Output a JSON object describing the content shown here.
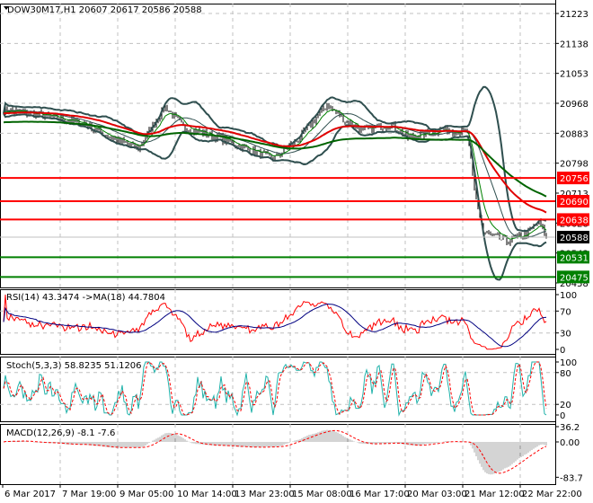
{
  "header": {
    "symbol": "DOW30M17,H1",
    "open": "20607",
    "high": "20617",
    "low": "20586",
    "close": "20588"
  },
  "chart_data": {
    "type": "line",
    "title": "DOW30M17,H1 20607 20617 20586 20588",
    "price_ticks": [
      "21223",
      "21138",
      "21053",
      "20968",
      "20883",
      "20798",
      "20713",
      "20628",
      "20543",
      "20458"
    ],
    "ylim": [
      20458,
      21223
    ],
    "price_anchors": [
      [
        0,
        20950
      ],
      [
        20,
        20935
      ],
      [
        45,
        20910
      ],
      [
        60,
        20870
      ],
      [
        75,
        20840
      ],
      [
        90,
        20960
      ],
      [
        100,
        20900
      ],
      [
        120,
        20870
      ],
      [
        140,
        20830
      ],
      [
        150,
        20810
      ],
      [
        165,
        20870
      ],
      [
        180,
        20965
      ],
      [
        190,
        20920
      ],
      [
        200,
        20890
      ],
      [
        215,
        20910
      ],
      [
        225,
        20870
      ],
      [
        245,
        20895
      ],
      [
        258,
        20885
      ],
      [
        262,
        20720
      ],
      [
        267,
        20600
      ],
      [
        280,
        20575
      ],
      [
        292,
        20600
      ],
      [
        298,
        20630
      ],
      [
        302,
        20588
      ]
    ],
    "levels": [
      {
        "value": "20756",
        "color": "#ff0000"
      },
      {
        "value": "20690",
        "color": "#ff0000"
      },
      {
        "value": "20638",
        "color": "#ff0000"
      },
      {
        "value": "20531",
        "color": "#008000"
      },
      {
        "value": "20475",
        "color": "#008000"
      }
    ],
    "current": {
      "value": "20588",
      "color": "#000000"
    },
    "x_labels": [
      "6 Mar 2017",
      "7 Mar 19:00",
      "9 Mar 05:00",
      "10 Mar 14:00",
      "13 Mar 23:00",
      "15 Mar 08:00",
      "16 Mar 17:00",
      "20 Mar 03:00",
      "21 Mar 12:00",
      "22 Mar 22:00"
    ],
    "rsi": {
      "label": "RSI(14) 43.3474  ->MA(18) 44.7804",
      "ticks": [
        "100",
        "70",
        "30",
        "0"
      ]
    },
    "stoch": {
      "label": "Stoch(5,3,3) 58.8235 51.1206",
      "ticks": [
        "100",
        "80",
        "20",
        "0"
      ]
    },
    "macd": {
      "label": "MACD(12,26,9) -8.1 -7.6",
      "ticks": [
        "36.2",
        "0.00",
        "-83.7"
      ]
    }
  }
}
